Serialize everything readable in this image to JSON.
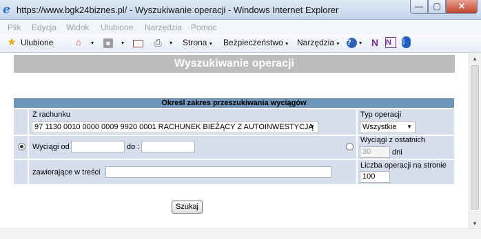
{
  "window": {
    "title": "https://www.bgk24biznes.pl/ - Wyszukiwanie operacji - Windows Internet Explorer",
    "logo_glyph": "e",
    "min_glyph": "—",
    "max_glyph": "▢",
    "close_glyph": "✕"
  },
  "menu": [
    "Plik",
    "Edycja",
    "Widok",
    "Ulubione",
    "Narzędzia",
    "Pomoc"
  ],
  "commandbar": {
    "favorites": "Ulubione",
    "page": "Strona",
    "security": "Bezpieczeństwo",
    "tools": "Narzędzia",
    "caret": "▾",
    "icons": [
      "star-icon",
      "home-icon",
      "rss-icon",
      "mail-icon",
      "print-icon",
      "help-icon",
      "onenote-icon",
      "onenote-clip-icon",
      "bluetooth-icon"
    ],
    "icon_glyphs": {
      "star": "★",
      "home": "⌂",
      "rss": "◙",
      "print": "⎙",
      "help": "?",
      "onenote": "N",
      "onenote2": "N",
      "bluetooth": "ᛒ"
    }
  },
  "page": {
    "header": "Wyszukiwanie operacji",
    "section_title": "Określ zakres przeszukiwania wyciągów",
    "account_label": "Z rachunku",
    "account_value": "97 1130 0010 0000 0009 9920 0001 RACHUNEK BIEŻĄCY Z AUTOINWESTYCJĄ",
    "op_type_label": "Typ operacji",
    "op_type_value": "Wszystkie",
    "statements_from_label": "Wyciągi od",
    "statements_from_value": "",
    "to_label": "do :",
    "to_value": "",
    "statements_last_label": "Wyciągi z ostatnich",
    "last_days_value": "30",
    "days_label": "dni",
    "contains_label": "zawierające w treści",
    "contains_value": "",
    "per_page_label": "Liczba operacji na stronie",
    "per_page_value": "100",
    "search_button": "Szukaj",
    "radio_range_selected": true,
    "radio_last_selected": false
  },
  "colors": {
    "header_bg": "#bcbcbc",
    "section_bg": "#6d95b9",
    "row_bg": "#d6deee"
  }
}
